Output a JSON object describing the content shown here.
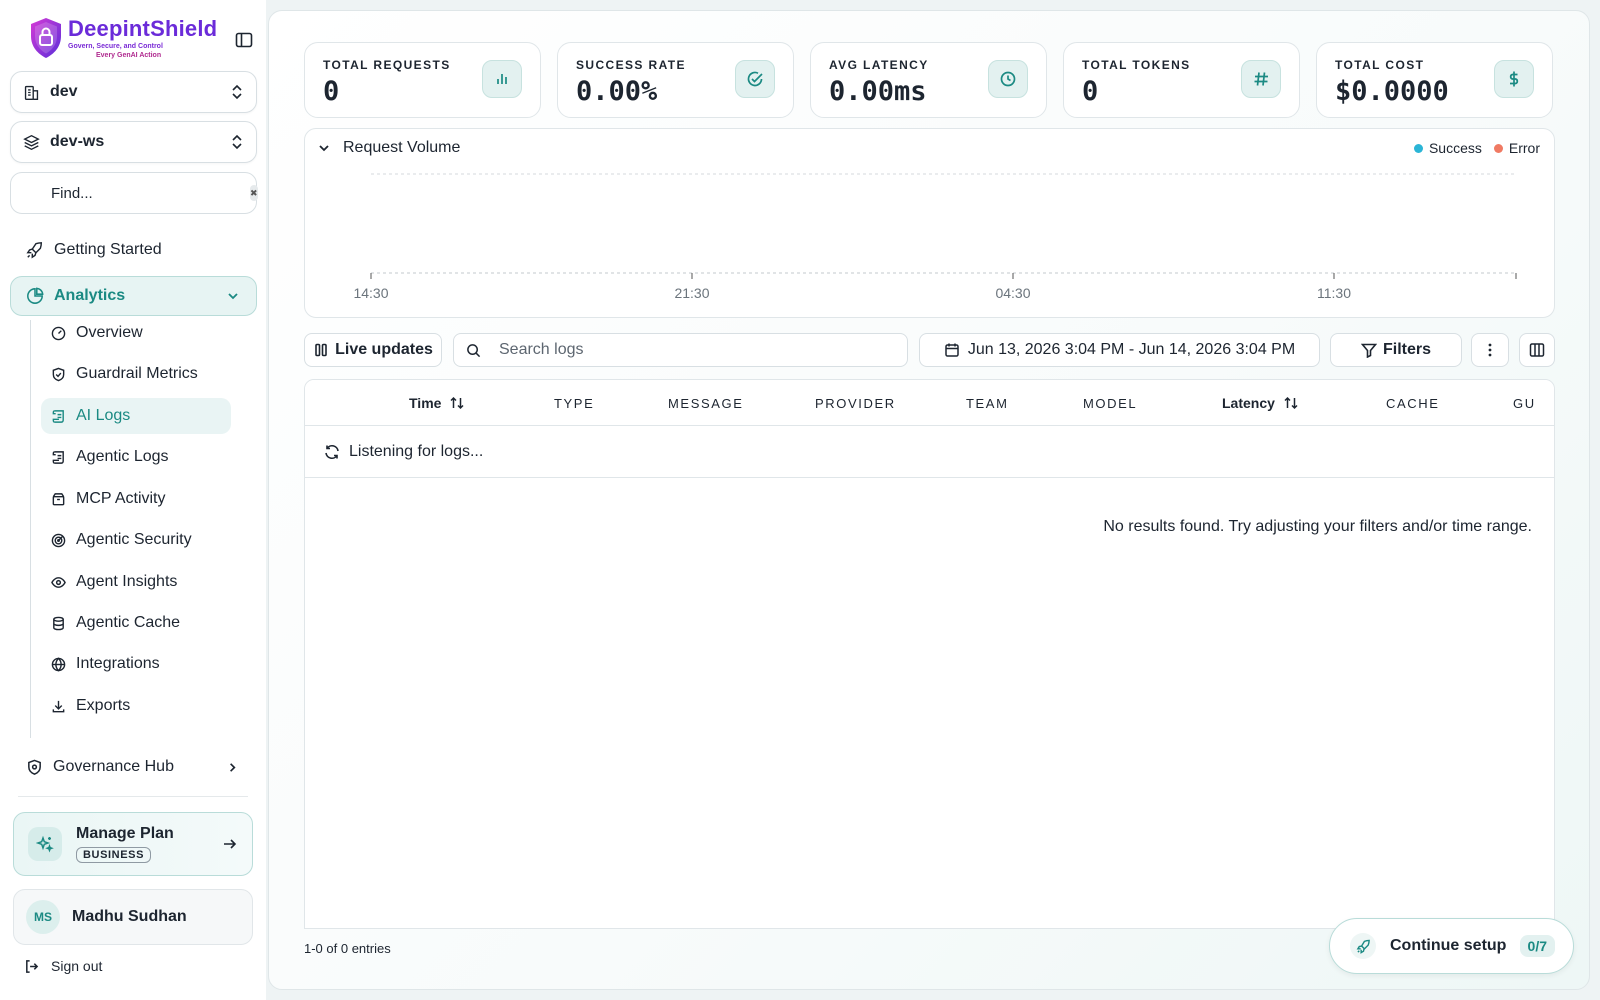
{
  "brand": {
    "name": "DeepintShield",
    "tagline_line1": "Govern, Secure, and Control",
    "tagline_line2": "Every GenAI Action"
  },
  "org_selector": {
    "value": "dev"
  },
  "workspace_selector": {
    "value": "dev-ws"
  },
  "find": {
    "placeholder": "Find..."
  },
  "nav": {
    "getting_started": "Getting Started",
    "analytics": "Analytics",
    "analytics_items": [
      {
        "label": "Overview",
        "icon": "gauge-icon"
      },
      {
        "label": "Guardrail Metrics",
        "icon": "shield-check-icon"
      },
      {
        "label": "AI Logs",
        "icon": "scroll-icon"
      },
      {
        "label": "Agentic Logs",
        "icon": "scroll-icon"
      },
      {
        "label": "MCP Activity",
        "icon": "box-icon"
      },
      {
        "label": "Agentic Security",
        "icon": "radar-icon"
      },
      {
        "label": "Agent Insights",
        "icon": "eye-icon"
      },
      {
        "label": "Agentic Cache",
        "icon": "database-icon"
      },
      {
        "label": "Integrations",
        "icon": "globe-icon"
      },
      {
        "label": "Exports",
        "icon": "download-icon"
      }
    ],
    "active_item": "AI Logs",
    "governance_hub": "Governance Hub"
  },
  "plan": {
    "title": "Manage Plan",
    "badge": "BUSINESS"
  },
  "user": {
    "initials": "MS",
    "name": "Madhu Sudhan"
  },
  "sign_out": "Sign out",
  "stats": [
    {
      "label": "TOTAL REQUESTS",
      "value": "0",
      "icon": "bar-chart-icon"
    },
    {
      "label": "SUCCESS RATE",
      "value": "0.00%",
      "icon": "check-circle-icon"
    },
    {
      "label": "AVG LATENCY",
      "value": "0.00ms",
      "icon": "clock-icon"
    },
    {
      "label": "TOTAL TOKENS",
      "value": "0",
      "icon": "hash-icon"
    },
    {
      "label": "TOTAL COST",
      "value": "$0.0000",
      "icon": "dollar-icon"
    }
  ],
  "chart_data": {
    "type": "bar",
    "title": "Request Volume",
    "categories": [
      "14:30",
      "21:30",
      "04:30",
      "11:30"
    ],
    "series": [
      {
        "name": "Success",
        "values": [
          0,
          0,
          0,
          0
        ],
        "color": "#2bb5d6"
      },
      {
        "name": "Error",
        "values": [
          0,
          0,
          0,
          0
        ],
        "color": "#f07a63"
      }
    ],
    "grid": true,
    "legend": "top-right"
  },
  "toolbar": {
    "live_updates": "Live updates",
    "search_placeholder": "Search logs",
    "date_range": "Jun 13, 2026 3:04 PM - Jun 14, 2026 3:04 PM",
    "filters": "Filters"
  },
  "table": {
    "columns": [
      "Time",
      "TYPE",
      "MESSAGE",
      "PROVIDER",
      "TEAM",
      "MODEL",
      "Latency",
      "CACHE",
      "GU"
    ],
    "listening": "Listening for logs...",
    "empty": "No results found. Try adjusting your filters and/or time range."
  },
  "footer": {
    "entries": "1-0 of 0 entries"
  },
  "setup": {
    "label": "Continue setup",
    "progress": "0/7"
  },
  "colors": {
    "accent": "#1b8a83",
    "brand": "#6b2bd9"
  }
}
